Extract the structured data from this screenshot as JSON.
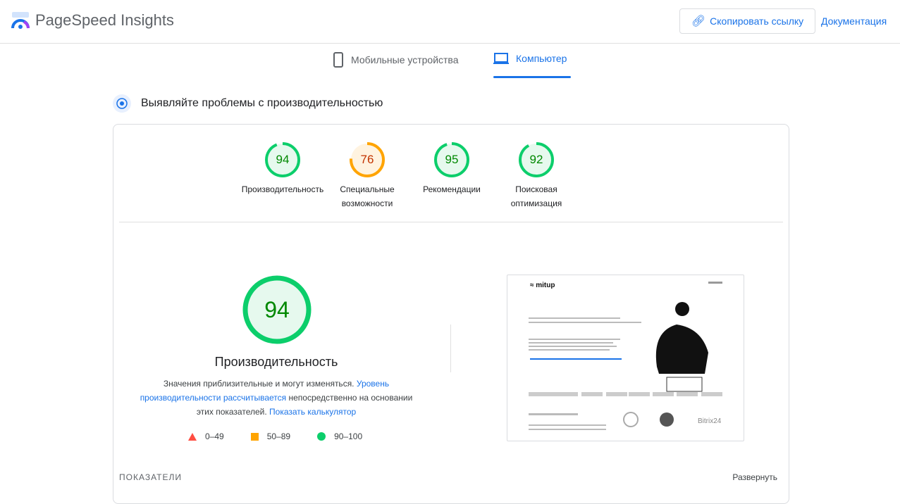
{
  "header": {
    "title": "PageSpeed Insights",
    "copy_link": "Скопировать ссылку",
    "docs": "Документация"
  },
  "tabs": [
    {
      "label": "Мобильные устройства"
    },
    {
      "label": "Компьютер"
    }
  ],
  "section_title": "Выявляйте проблемы с производительностью",
  "scores": [
    {
      "value": "94",
      "label": "Производительность",
      "status": "good"
    },
    {
      "value": "76",
      "label": "Специальные возможности",
      "status": "average"
    },
    {
      "value": "95",
      "label": "Рекомендации",
      "status": "good"
    },
    {
      "value": "92",
      "label": "Поисковая оптимизация",
      "status": "good"
    }
  ],
  "main_score": {
    "value": "94",
    "title": "Производительность",
    "desc_1": "Значения приблизительные и могут изменяться.",
    "link_1": "Уровень производительности рассчитывается",
    "desc_2": "непосредственно на основании этих показателей.",
    "link_2": "Показать калькулятор"
  },
  "legend": [
    {
      "range": "0–49",
      "color": "#ff4e42"
    },
    {
      "range": "50–89",
      "color": "#ffa400"
    },
    {
      "range": "90–100",
      "color": "#0cce6b"
    }
  ],
  "screenshot": {
    "logo": "mitup",
    "bitrix": "Bitrix 24"
  },
  "footer": {
    "metrics": "ПОКАЗАТЕЛИ",
    "expand": "Развернуть"
  },
  "colors": {
    "good": "#0cce6b",
    "good_text": "#008800",
    "avg": "#ffa400",
    "avg_text": "#c33300",
    "link": "#1a73e8"
  }
}
